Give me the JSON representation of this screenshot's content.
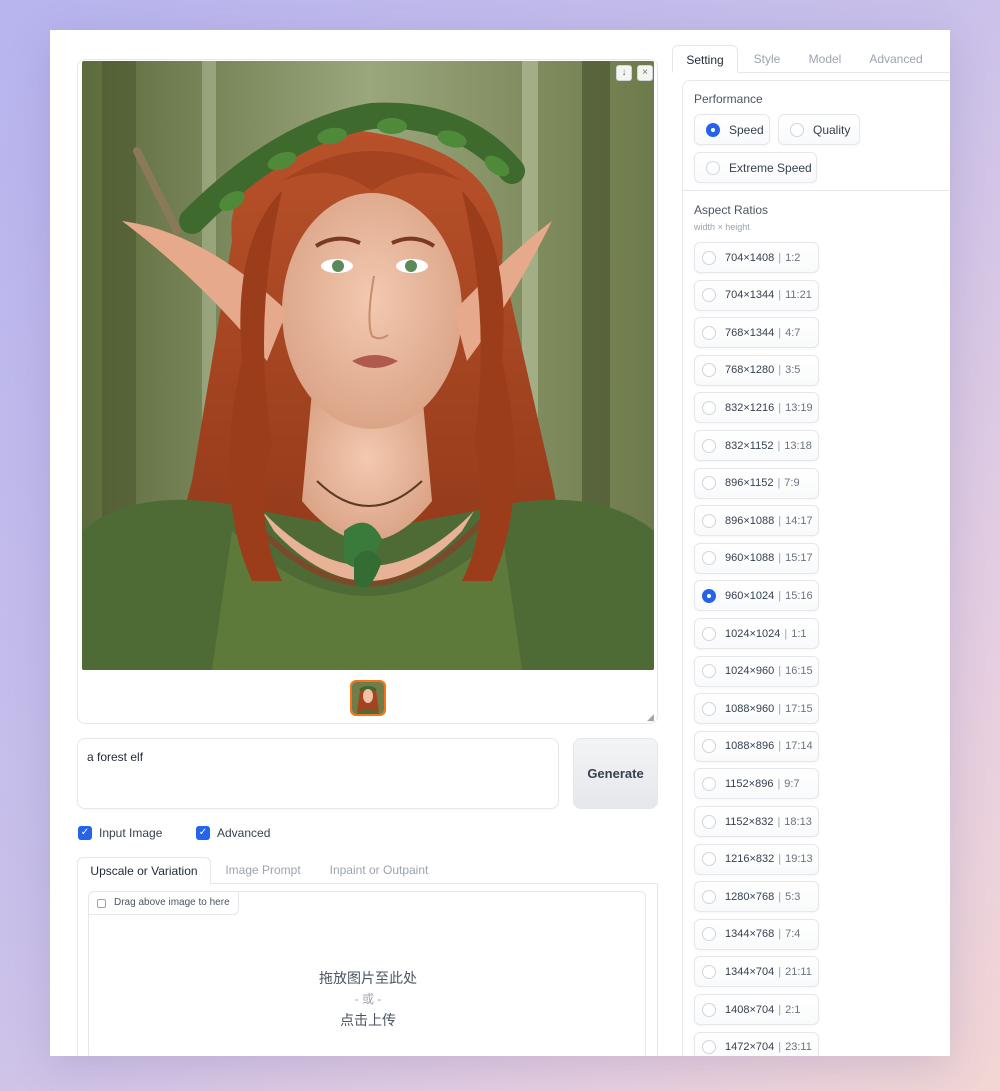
{
  "gallery": {
    "download_icon": "download-icon",
    "close_icon": "close-icon"
  },
  "prompt": {
    "value": "a forest elf"
  },
  "generate": {
    "label": "Generate"
  },
  "checks": [
    {
      "label": "Input Image",
      "checked": true
    },
    {
      "label": "Advanced",
      "checked": true
    }
  ],
  "input_tabs": [
    {
      "label": "Upscale or Variation",
      "active": true
    },
    {
      "label": "Image Prompt",
      "active": false
    },
    {
      "label": "Inpaint or Outpaint",
      "active": false
    }
  ],
  "upload": {
    "drag_label": "Drag above image to here",
    "drop_text": "拖放图片至此处",
    "or_text": "- 或 -",
    "click_text": "点击上传"
  },
  "settings_tabs": [
    {
      "label": "Setting",
      "active": true
    },
    {
      "label": "Style",
      "active": false
    },
    {
      "label": "Model",
      "active": false
    },
    {
      "label": "Advanced",
      "active": false
    }
  ],
  "performance": {
    "label": "Performance",
    "options": [
      {
        "label": "Speed",
        "selected": true
      },
      {
        "label": "Quality",
        "selected": false
      },
      {
        "label": "Extreme Speed",
        "selected": false
      }
    ]
  },
  "aspect": {
    "label": "Aspect Ratios",
    "sublabel": "width × height",
    "separator": "|",
    "options": [
      {
        "size": "704×1408",
        "ratio": "1:2",
        "selected": false
      },
      {
        "size": "704×1344",
        "ratio": "11:21",
        "selected": false
      },
      {
        "size": "768×1344",
        "ratio": "4:7",
        "selected": false
      },
      {
        "size": "768×1280",
        "ratio": "3:5",
        "selected": false
      },
      {
        "size": "832×1216",
        "ratio": "13:19",
        "selected": false
      },
      {
        "size": "832×1152",
        "ratio": "13:18",
        "selected": false
      },
      {
        "size": "896×1152",
        "ratio": "7:9",
        "selected": false
      },
      {
        "size": "896×1088",
        "ratio": "14:17",
        "selected": false
      },
      {
        "size": "960×1088",
        "ratio": "15:17",
        "selected": false
      },
      {
        "size": "960×1024",
        "ratio": "15:16",
        "selected": true
      },
      {
        "size": "1024×1024",
        "ratio": "1:1",
        "selected": false
      },
      {
        "size": "1024×960",
        "ratio": "16:15",
        "selected": false
      },
      {
        "size": "1088×960",
        "ratio": "17:15",
        "selected": false
      },
      {
        "size": "1088×896",
        "ratio": "17:14",
        "selected": false
      },
      {
        "size": "1152×896",
        "ratio": "9:7",
        "selected": false
      },
      {
        "size": "1152×832",
        "ratio": "18:13",
        "selected": false
      },
      {
        "size": "1216×832",
        "ratio": "19:13",
        "selected": false
      },
      {
        "size": "1280×768",
        "ratio": "5:3",
        "selected": false
      },
      {
        "size": "1344×768",
        "ratio": "7:4",
        "selected": false
      },
      {
        "size": "1344×704",
        "ratio": "21:11",
        "selected": false
      },
      {
        "size": "1408×704",
        "ratio": "2:1",
        "selected": false
      },
      {
        "size": "1472×704",
        "ratio": "23:11",
        "selected": false
      }
    ]
  },
  "colors": {
    "accent": "#2563eb",
    "thumb_border": "#f97316"
  }
}
